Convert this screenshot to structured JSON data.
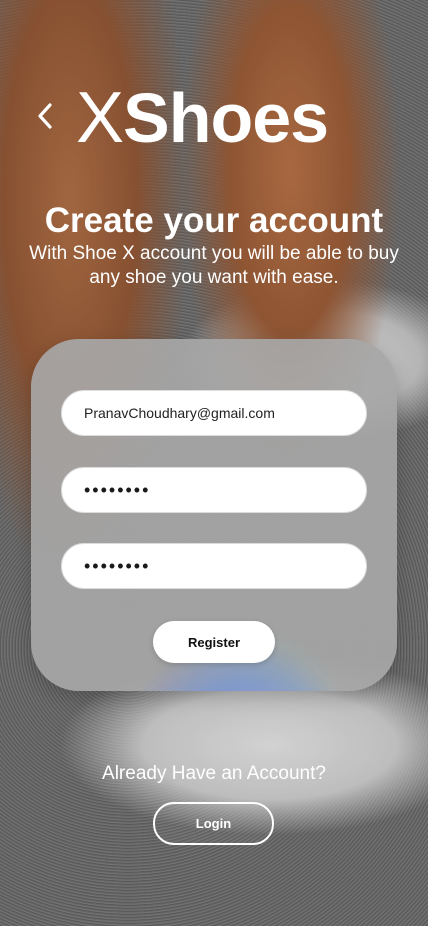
{
  "brand": {
    "prefix": "X",
    "name": "Shoes"
  },
  "header": {
    "title": "Create your account",
    "subtitle": "With Shoe X account you will be able to buy any shoe you want with ease."
  },
  "form": {
    "email_value": "PranavChoudhary@gmail.com",
    "password_value": "••••••••",
    "confirm_password_value": "••••••••",
    "register_label": "Register"
  },
  "footer": {
    "prompt": "Already Have an Account?",
    "login_label": "Login"
  },
  "icons": {
    "back": "chevron-left-icon"
  },
  "colors": {
    "text": "#ffffff",
    "field_bg": "#ffffff",
    "button_text": "#111111"
  }
}
